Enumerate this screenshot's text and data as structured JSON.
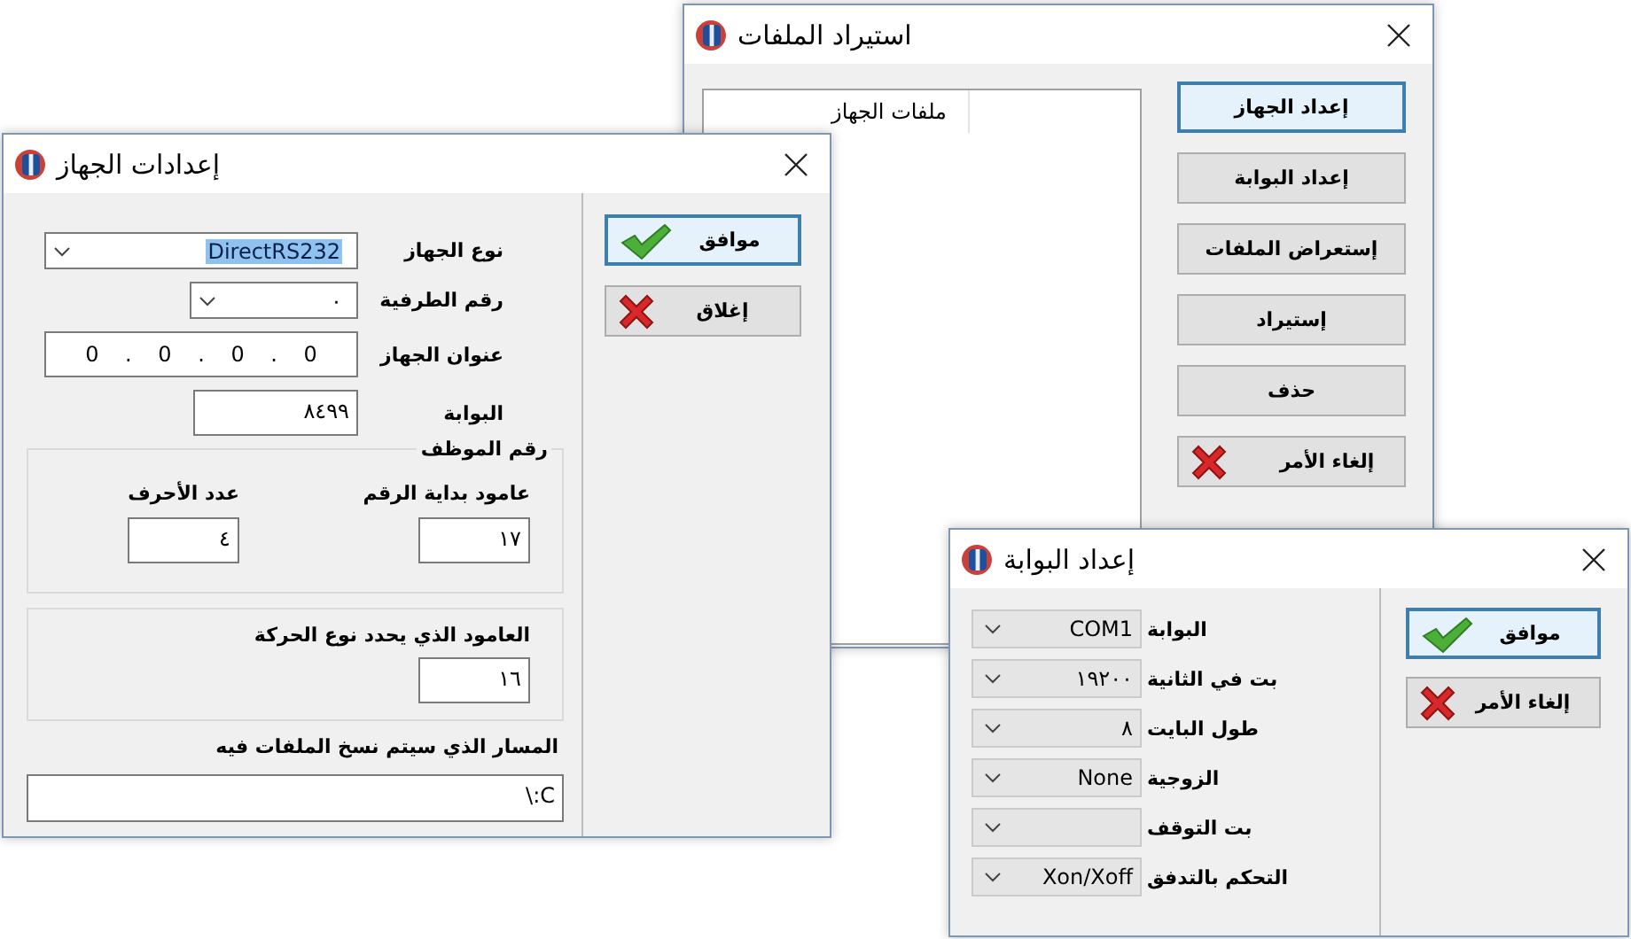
{
  "import_window": {
    "title": "استيراد الملفات",
    "list": {
      "columns": [
        "ملفات الجهاز"
      ]
    },
    "buttons": [
      {
        "label": "إعداد الجهاز",
        "kind": "plain",
        "focused": true
      },
      {
        "label": "إعداد البوابة",
        "kind": "plain",
        "focused": false
      },
      {
        "label": "إستعراض الملفات",
        "kind": "plain",
        "focused": false
      },
      {
        "label": "إستيراد",
        "kind": "plain",
        "focused": false
      },
      {
        "label": "حذف",
        "kind": "plain",
        "focused": false
      },
      {
        "label": "إلغاء الأمر",
        "kind": "cancel",
        "focused": false
      }
    ]
  },
  "device_window": {
    "title": "إعدادات الجهاز",
    "fields": [
      {
        "kind": "dropdown",
        "label": "نوع الجهاز",
        "value": "DirectRS232",
        "highlighted": true
      },
      {
        "kind": "dropdown",
        "label": "رقم الطرفية",
        "value": "٠",
        "highlighted": false
      },
      {
        "kind": "address",
        "label": "عنوان الجهاز",
        "value": "0 . 0 . 0 . 0"
      },
      {
        "kind": "text",
        "label": "البوابة",
        "value": "٨٤٩٩"
      }
    ],
    "employee_group": {
      "title": "رقم الموظف",
      "fields": [
        {
          "label": "عامود بداية الرقم",
          "value": "١٧"
        },
        {
          "label": "عدد الأحرف",
          "value": "٤"
        }
      ]
    },
    "movement_group": {
      "label": "العامود الذي يحدد نوع الحركة",
      "value": "١٦"
    },
    "path": {
      "label": "المسار الذي سيتم نسخ الملفات فيه",
      "value": "\\:C"
    },
    "buttons": [
      {
        "label": "موافق",
        "kind": "confirm",
        "focused": true
      },
      {
        "label": "إغلاق",
        "kind": "cancel",
        "focused": false
      }
    ]
  },
  "port_window": {
    "title": "إعداد البوابة",
    "fields": [
      {
        "label": "البوابة",
        "value": "COM1"
      },
      {
        "label": "بت في الثانية",
        "value": "١٩٢٠٠"
      },
      {
        "label": "طول البايت",
        "value": "٨"
      },
      {
        "label": "الزوجية",
        "value": "None"
      },
      {
        "label": "بت التوقف"
      },
      {
        "label": "التحكم بالتدفق",
        "value": "Xon/Xoff"
      }
    ],
    "buttons": [
      {
        "label": "موافق",
        "kind": "confirm",
        "focused": true
      },
      {
        "label": "إلغاء الأمر",
        "kind": "cancel",
        "focused": false
      }
    ]
  }
}
